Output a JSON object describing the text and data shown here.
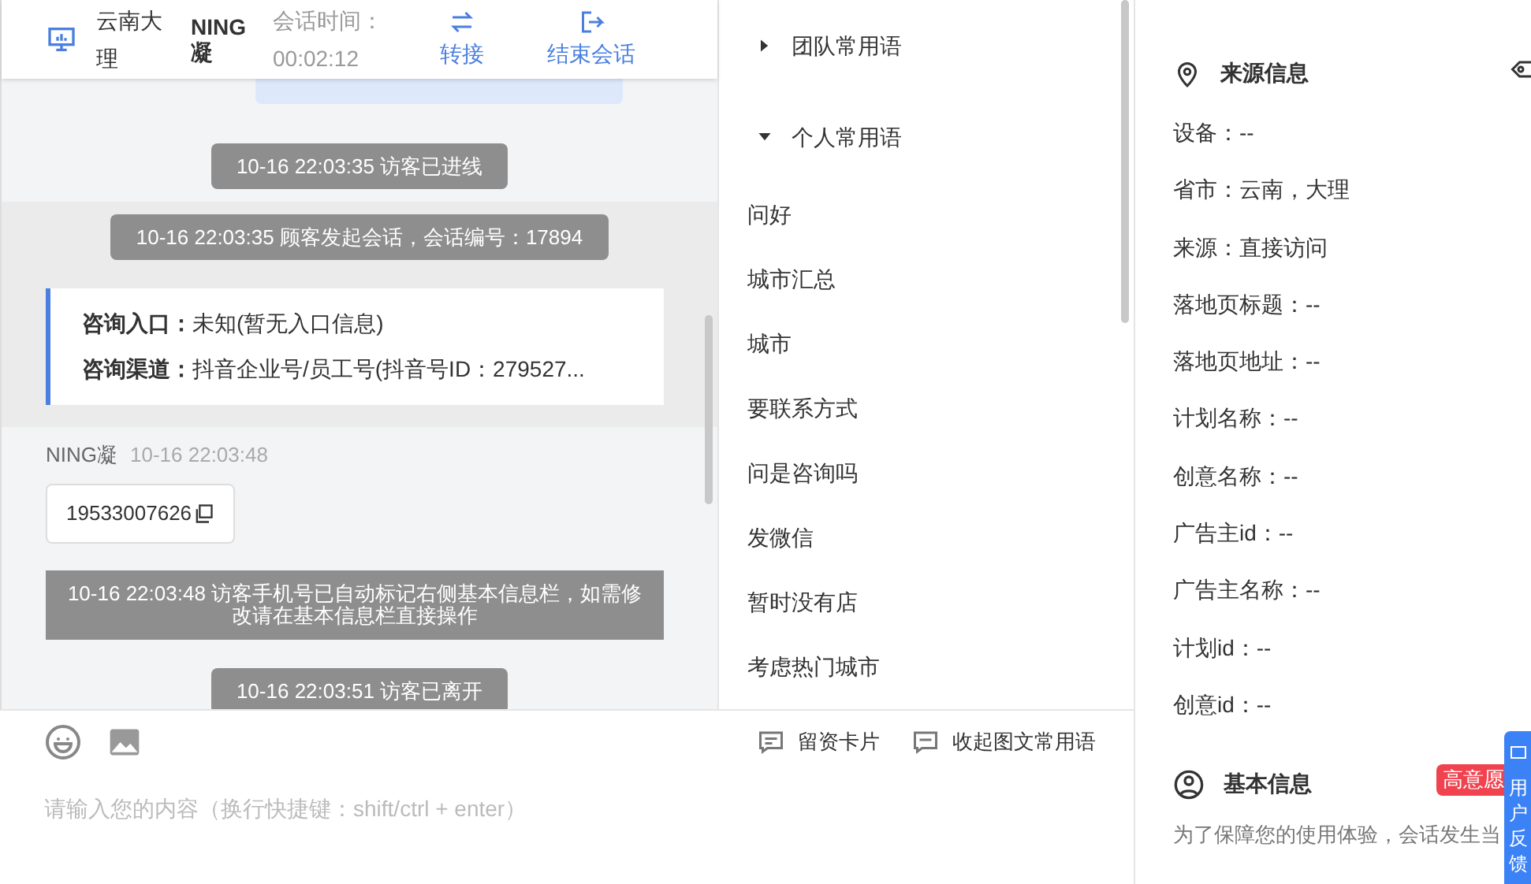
{
  "header": {
    "location": "云南大理",
    "visitor": "NING凝",
    "timer_label": "会话时间：",
    "timer": "00:02:12",
    "actions": [
      {
        "kind": "transfer",
        "label": "转接"
      },
      {
        "kind": "end",
        "label": "结束会话"
      }
    ]
  },
  "chat": [
    {
      "kind": "bubble_cut"
    },
    {
      "kind": "system",
      "text": "10-16 22:03:35 访客已进线"
    },
    {
      "kind": "system",
      "text": "10-16 22:03:35 顾客发起会话，会话编号：17894",
      "band": true
    },
    {
      "kind": "info",
      "band": true,
      "lines": [
        {
          "label": "咨询入口：",
          "value": "未知(暂无入口信息)"
        },
        {
          "label": "咨询渠道：",
          "value": "抖音企业号/员工号(抖音号ID：279527..."
        }
      ]
    },
    {
      "kind": "message",
      "sender": "NING凝",
      "time": "10-16 22:03:48",
      "text": "19533007626"
    },
    {
      "kind": "notice",
      "text": "10-16 22:03:48 访客手机号已自动标记右侧基本信息栏，如需修改请在基本信息栏直接操作"
    },
    {
      "kind": "system",
      "text": "10-16 22:03:51 访客已离开"
    }
  ],
  "composer": {
    "tools": [
      {
        "kind": "card",
        "label": "留资卡片"
      },
      {
        "kind": "phrases",
        "label": "收起图文常用语"
      }
    ],
    "placeholder": "请输入您的内容（换行快捷键：shift/ctrl + enter）"
  },
  "phrases": {
    "groups": [
      {
        "label": "团队常用语",
        "expanded": false
      },
      {
        "label": "个人常用语",
        "expanded": true,
        "items": [
          "问好",
          "城市汇总",
          "城市",
          "要联系方式",
          "问是咨询吗",
          "发微信",
          "暂时没有店",
          "考虑热门城市"
        ]
      }
    ]
  },
  "source_info": {
    "title": "来源信息",
    "fields": [
      "设备：--",
      "省市：云南，大理",
      "来源：直接访问",
      "落地页标题：--",
      "落地页地址：--",
      "计划名称：--",
      "创意名称：--",
      "广告主id：--",
      "广告主名称：--",
      "计划id：--",
      "创意id：--"
    ]
  },
  "basic_info": {
    "title": "基本信息",
    "tag": "高意愿",
    "note": "为了保障您的使用体验，会话发生当"
  },
  "feedback_tab": "用户反馈"
}
